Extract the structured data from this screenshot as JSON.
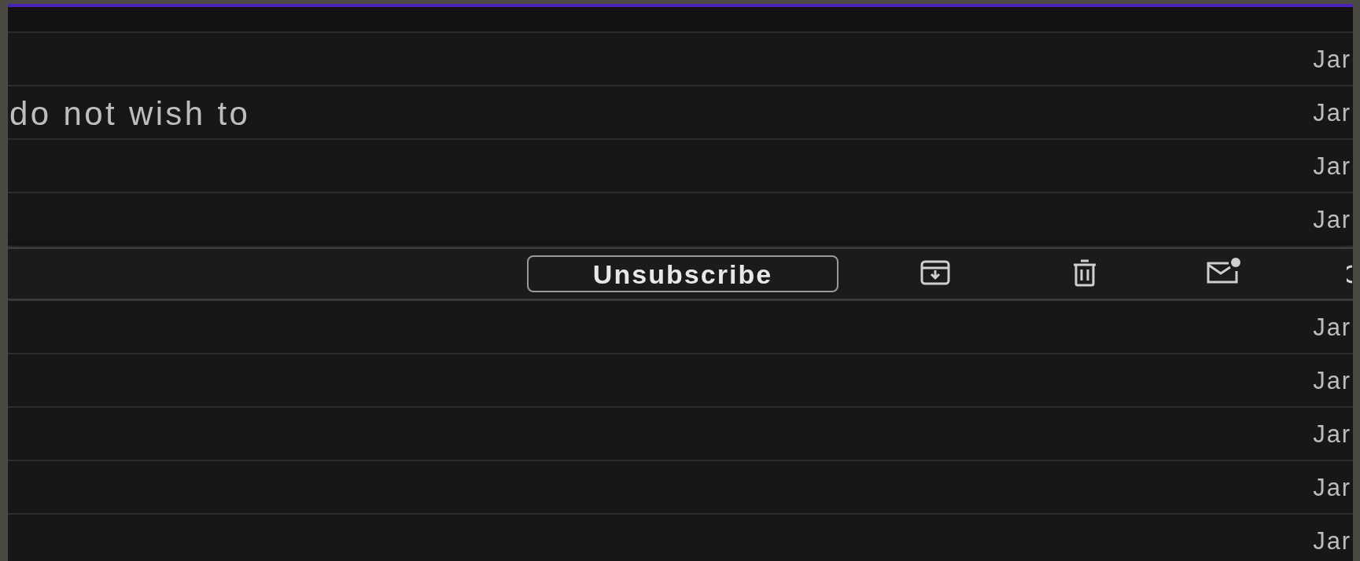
{
  "rows": [
    {
      "hovered": false
    },
    {
      "hovered": false,
      "date": "Jar"
    },
    {
      "hovered": false,
      "snippet": "do not wish to",
      "date": "Jar"
    },
    {
      "hovered": false,
      "date": "Jar"
    },
    {
      "hovered": false,
      "date": "Jar"
    },
    {
      "hovered": true,
      "unsubscribe_label": "Unsubscribe"
    },
    {
      "hovered": false,
      "date": "Jar"
    },
    {
      "hovered": false,
      "date": "Jar"
    },
    {
      "hovered": false,
      "date": "Jar"
    },
    {
      "hovered": false,
      "date": "Jar"
    },
    {
      "hovered": false,
      "date": "Jar"
    }
  ]
}
